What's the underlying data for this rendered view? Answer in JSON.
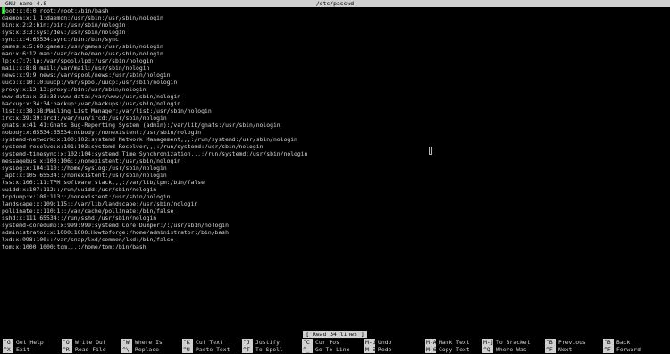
{
  "titlebar": {
    "app": "GNU nano 4.8",
    "file": "/etc/passwd"
  },
  "first_line_rest": "oot:x:0:0:root:/root:/bin/bash",
  "lines": [
    "daemon:x:1:1:daemon:/usr/sbin:/usr/sbin/nologin",
    "bin:x:2:2:bin:/bin:/usr/sbin/nologin",
    "sys:x:3:3:sys:/dev:/usr/sbin/nologin",
    "sync:x:4:65534:sync:/bin:/bin/sync",
    "games:x:5:60:games:/usr/games:/usr/sbin/nologin",
    "man:x:6:12:man:/var/cache/man:/usr/sbin/nologin",
    "lp:x:7:7:lp:/var/spool/lpd:/usr/sbin/nologin",
    "mail:x:8:8:mail:/var/mail:/usr/sbin/nologin",
    "news:x:9:9:news:/var/spool/news:/usr/sbin/nologin",
    "uucp:x:10:10:uucp:/var/spool/uucp:/usr/sbin/nologin",
    "proxy:x:13:13:proxy:/bin:/usr/sbin/nologin",
    "www-data:x:33:33:www-data:/var/www:/usr/sbin/nologin",
    "backup:x:34:34:backup:/var/backups:/usr/sbin/nologin",
    "list:x:38:38:Mailing List Manager:/var/list:/usr/sbin/nologin",
    "irc:x:39:39:ircd:/var/run/ircd:/usr/sbin/nologin",
    "gnats:x:41:41:Gnats Bug-Reporting System (admin):/var/lib/gnats:/usr/sbin/nologin",
    "nobody:x:65534:65534:nobody:/nonexistent:/usr/sbin/nologin",
    "systemd-network:x:100:102:systemd Network Management,,,:/run/systemd:/usr/sbin/nologin",
    "systemd-resolve:x:101:103:systemd Resolver,,,:/run/systemd:/usr/sbin/nologin",
    "systemd-timesync:x:102:104:systemd Time Synchronization,,,:/run/systemd:/usr/sbin/nologin",
    "messagebus:x:103:106::/nonexistent:/usr/sbin/nologin",
    "syslog:x:104:110::/home/syslog:/usr/sbin/nologin",
    "_apt:x:105:65534::/nonexistent:/usr/sbin/nologin",
    "tss:x:106:111:TPM software stack,,,:/var/lib/tpm:/bin/false",
    "uuidd:x:107:112::/run/uuidd:/usr/sbin/nologin",
    "tcpdump:x:108:113::/nonexistent:/usr/sbin/nologin",
    "landscape:x:109:115::/var/lib/landscape:/usr/sbin/nologin",
    "pollinate:x:110:1::/var/cache/pollinate:/bin/false",
    "sshd:x:111:65534::/run/sshd:/usr/sbin/nologin",
    "systemd-coredump:x:999:999:systemd Core Dumper:/:/usr/sbin/nologin",
    "administrator:x:1000:1000:Howtoforge:/home/administrator:/bin/bash",
    "lxd:x:998:100::/var/snap/lxd/common/lxd:/bin/false",
    "tom:x:1000:1000:tom,,,:/home/tom:/bin/bash"
  ],
  "status": "[ Read 34 lines ]",
  "shortcuts": [
    {
      "key": "^G",
      "label": "Get Help"
    },
    {
      "key": "^X",
      "label": "Exit"
    },
    {
      "key": "^O",
      "label": "Write Out"
    },
    {
      "key": "^R",
      "label": "Read File"
    },
    {
      "key": "^W",
      "label": "Where Is"
    },
    {
      "key": "^\\",
      "label": "Replace"
    },
    {
      "key": "^K",
      "label": "Cut Text"
    },
    {
      "key": "^U",
      "label": "Paste Text"
    },
    {
      "key": "^J",
      "label": "Justify"
    },
    {
      "key": "^T",
      "label": "To Spell"
    },
    {
      "key": "^C",
      "label": "Cur Pos"
    },
    {
      "key": "^_",
      "label": "Go To Line"
    },
    {
      "key": "M-U",
      "label": "Undo"
    },
    {
      "key": "M-E",
      "label": "Redo"
    },
    {
      "key": "M-A",
      "label": "Mark Text"
    },
    {
      "key": "M-6",
      "label": "Copy Text"
    },
    {
      "key": "M-]",
      "label": "To Bracket"
    },
    {
      "key": "^Q",
      "label": "Where Was"
    },
    {
      "key": "^B",
      "label": "Previous"
    },
    {
      "key": "^F",
      "label": "Next"
    },
    {
      "key": "^B",
      "label": "Back"
    },
    {
      "key": "^F",
      "label": "Forward"
    }
  ],
  "colors": {
    "cursor": "#1bd11b",
    "bar": "#d0d0d0",
    "background": "#000000"
  }
}
